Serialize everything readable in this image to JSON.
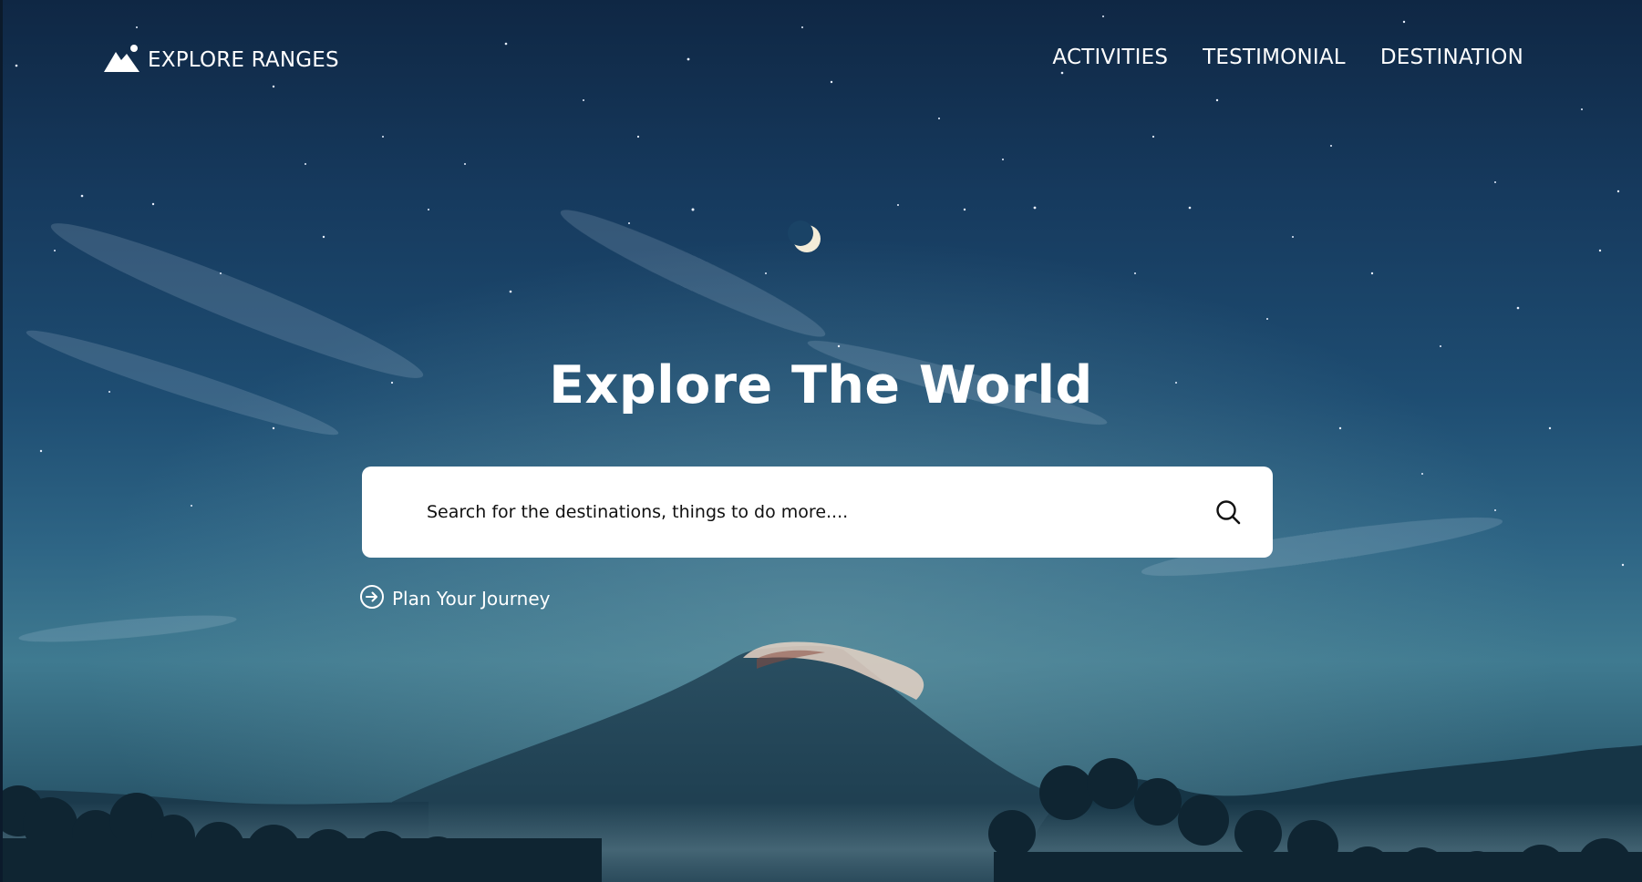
{
  "brand": {
    "name": "EXPLORE RANGES",
    "logo_icon": "mountain-icon"
  },
  "nav": {
    "items": [
      {
        "label": "ACTIVITIES"
      },
      {
        "label": "TESTIMONIAL"
      },
      {
        "label": "DESTINATION"
      }
    ]
  },
  "hero": {
    "title": "Explore The World",
    "background": "night sky with crescent moon over a volcanic mountain"
  },
  "search": {
    "placeholder": "Search for the destinations, things to do more....",
    "value": "",
    "icon": "search-icon"
  },
  "plan": {
    "label": "Plan Your Journey",
    "icon": "arrow-circle-right-icon"
  },
  "colors": {
    "text": "#ffffff",
    "search_bg": "#ffffff",
    "search_text": "#111111",
    "sky_top": "#0f2744",
    "sky_mid": "#1e4d72",
    "mountain": "#1d3f53"
  }
}
